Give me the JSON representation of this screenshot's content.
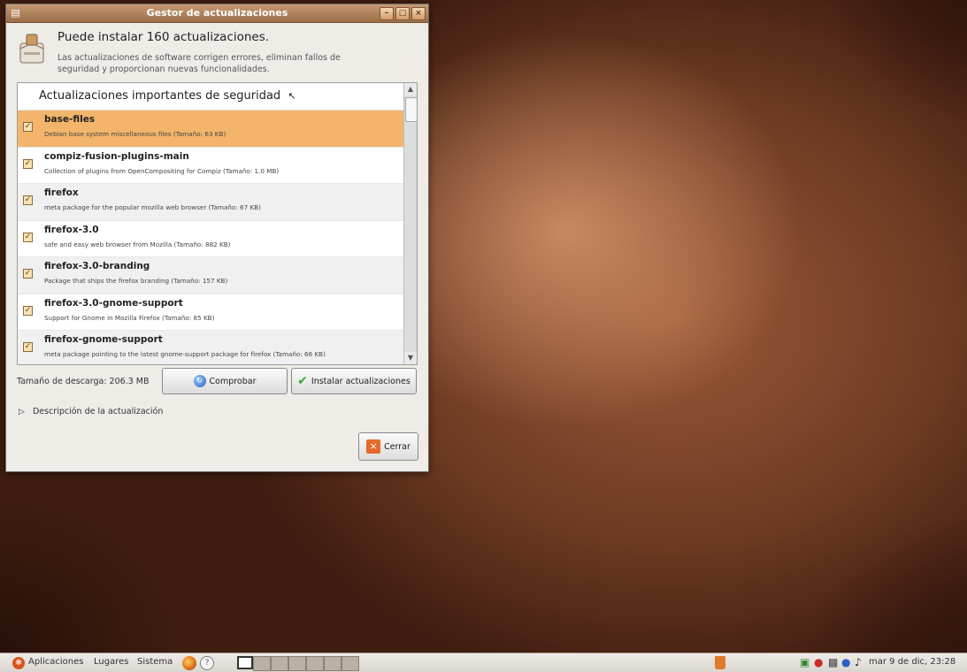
{
  "window": {
    "title": "Gestor de actualizaciones",
    "app_icon": "package-icon",
    "buttons": [
      "minimize-icon",
      "maximize-icon",
      "close-icon"
    ]
  },
  "header": {
    "title": "Puede instalar 160 actualizaciones.",
    "subtitle": "Las actualizaciones de software corrigen errores, eliminan fallos de seguridad y proporcionan nuevas funcionalidades."
  },
  "list": {
    "section_title": "Actualizaciones importantes de seguridad",
    "items": [
      {
        "name": "base-files",
        "description": "Debian base system miscellaneous files (Tamaño: 63 KB)",
        "checked": true
      },
      {
        "name": "compiz-fusion-plugins-main",
        "description": "Collection of plugins from OpenCompositing for Compiz (Tamaño: 1.0 MB)",
        "checked": true
      },
      {
        "name": "firefox",
        "description": "meta package for the popular mozilla web browser (Tamaño: 67 KB)",
        "checked": true
      },
      {
        "name": "firefox-3.0",
        "description": "safe and easy web browser from Mozilla (Tamaño: 882 KB)",
        "checked": true
      },
      {
        "name": "firefox-3.0-branding",
        "description": "Package that ships the firefox branding (Tamaño: 157 KB)",
        "checked": true
      },
      {
        "name": "firefox-3.0-gnome-support",
        "description": "Support for Gnome in Mozilla Firefox (Tamaño: 85 KB)",
        "checked": true
      },
      {
        "name": "firefox-gnome-support",
        "description": "meta package pointing to the latest gnome-support package for firefox (Tamaño: 66 KB)",
        "checked": true
      }
    ]
  },
  "footer": {
    "download_size": "Tamaño de descarga: 206.3 MB",
    "check_label": "Comprobar",
    "install_label": "Instalar actualizaciones",
    "details_label": "Descripción de la actualización",
    "close_label": "Cerrar"
  },
  "panel": {
    "menus": [
      "Aplicaciones",
      "Lugares",
      "Sistema"
    ],
    "clock": "mar 9 de dic, 23:28"
  }
}
